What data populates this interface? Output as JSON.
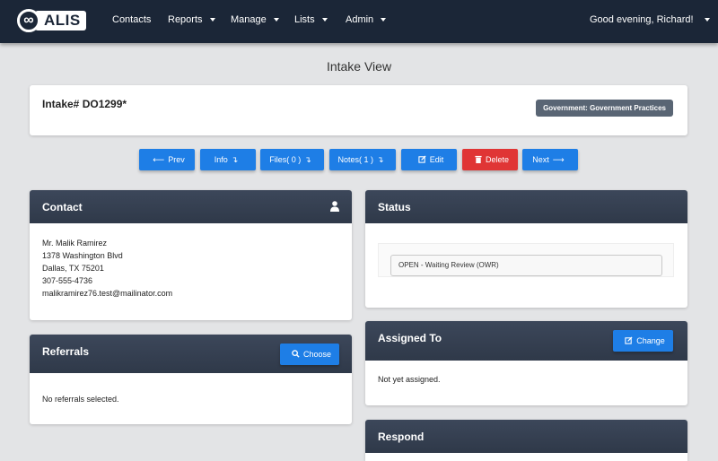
{
  "brand": {
    "logo_text": "ALIS",
    "logo_mark": "∞"
  },
  "nav": {
    "items": [
      {
        "label": "Contacts",
        "dropdown": false
      },
      {
        "label": "Reports",
        "dropdown": true
      },
      {
        "label": "Manage",
        "dropdown": true
      },
      {
        "label": "Lists",
        "dropdown": true
      },
      {
        "label": "Admin",
        "dropdown": true
      }
    ],
    "greeting": "Good evening, Richard!"
  },
  "page": {
    "title": "Intake View"
  },
  "intake": {
    "title": "Intake# DO1299*",
    "badge": "Government: Government Practices"
  },
  "actions": {
    "prev": "Prev",
    "info": "Info",
    "files": "Files(  0  )",
    "notes": "Notes(  1  )",
    "edit": "Edit",
    "delete": "Delete",
    "next": "Next"
  },
  "contact": {
    "header": "Contact",
    "name": "Mr. Malik Ramirez",
    "address1": "1378 Washington Blvd",
    "address2": "Dallas, TX 75201",
    "phone": "307-555-4736",
    "email": "malikramirez76.test@mailinator.com"
  },
  "status": {
    "header": "Status",
    "value": "OPEN - Waiting Review (OWR)"
  },
  "referrals": {
    "header": "Referrals",
    "button": "Choose",
    "empty": "No referrals selected."
  },
  "assigned": {
    "header": "Assigned To",
    "button": "Change",
    "empty": "Not yet assigned."
  },
  "respond": {
    "header": "Respond"
  },
  "colors": {
    "navbar": "#1b2637",
    "primary": "#1e7ee6",
    "danger": "#e03535",
    "panel_header": "#354052",
    "badge": "#596574"
  }
}
